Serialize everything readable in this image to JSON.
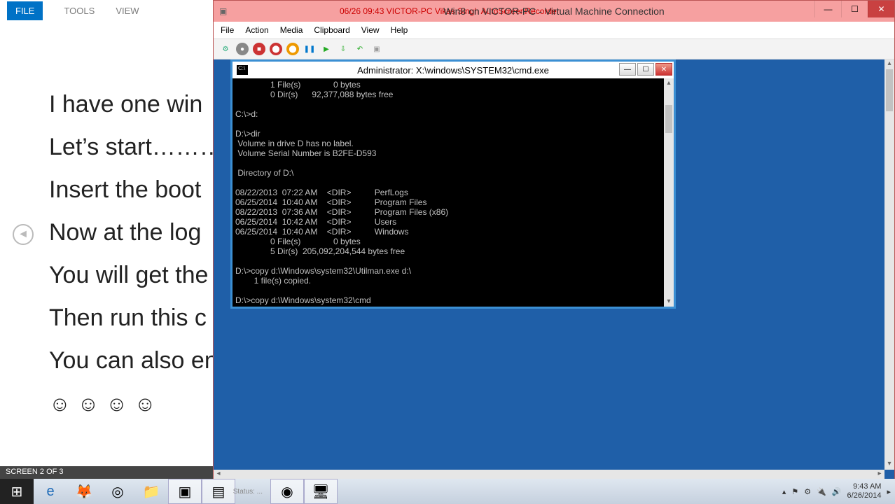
{
  "bg": {
    "tabs": {
      "file": "FILE",
      "tools": "TOOLS",
      "view": "VIEW"
    },
    "lines": [
      "I have one win",
      "Let’s start……….",
      "Insert the boot",
      "Now at the log",
      "You will get the",
      "Then run this c",
      "You can also en"
    ],
    "emoji": "☺",
    "status": "SCREEN 2 OF 3",
    "nav_arrow": "◄"
  },
  "vm": {
    "status_text": "06/26 09:43 VICTOR-PC  Vikas Singh  AutoScreenRecorder",
    "title": "Win8 on VICTOR-PC - Virtual Machine Connection",
    "menu": [
      "File",
      "Action",
      "Media",
      "Clipboard",
      "View",
      "Help"
    ],
    "ctrl": {
      "min": "—",
      "max": "☐",
      "close": "✕"
    },
    "tools": {
      "connect": "⚙",
      "start": "●",
      "stop": "■",
      "shutdown": "⬤",
      "save": "⬤",
      "pause": "❚❚",
      "resume": "▶",
      "checkpoint": "⇩",
      "revert": "↶",
      "enhanced": "▣"
    }
  },
  "cmd": {
    "title": "Administrator: X:\\windows\\SYSTEM32\\cmd.exe",
    "icon_text": "C:\\",
    "ctrl": {
      "min": "—",
      "max": "☐",
      "close": "✕"
    },
    "text": "               1 File(s)              0 bytes\n               0 Dir(s)      92,377,088 bytes free\n\nC:\\>d:\n\nD:\\>dir\n Volume in drive D has no label.\n Volume Serial Number is B2FE-D593\n\n Directory of D:\\\n\n08/22/2013  07:22 AM    <DIR>          PerfLogs\n06/25/2014  10:40 AM    <DIR>          Program Files\n08/22/2013  07:36 AM    <DIR>          Program Files (x86)\n06/25/2014  10:42 AM    <DIR>          Users\n06/25/2014  10:40 AM    <DIR>          Windows\n               0 File(s)              0 bytes\n               5 Dir(s)  205,092,204,544 bytes free\n\nD:\\>copy d:\\Windows\\system32\\Utilman.exe d:\\\n        1 file(s) copied.\n\nD:\\>copy d:\\Windows\\system32\\cmd"
  },
  "taskbar": {
    "start": "⊞",
    "ie": "e",
    "ff": "🦊",
    "chrome": "◎",
    "files": "📁",
    "app1": "▣",
    "app2": "▤",
    "app3": "◉",
    "app4": "🖥",
    "status_mini": "Status: ...",
    "tray": {
      "up": "▴",
      "flag": "⚑",
      "net": "⚙",
      "power": "🔌",
      "snd": "🔊",
      "more": "▸"
    },
    "time": "9:43 AM",
    "date": "6/26/2014"
  }
}
